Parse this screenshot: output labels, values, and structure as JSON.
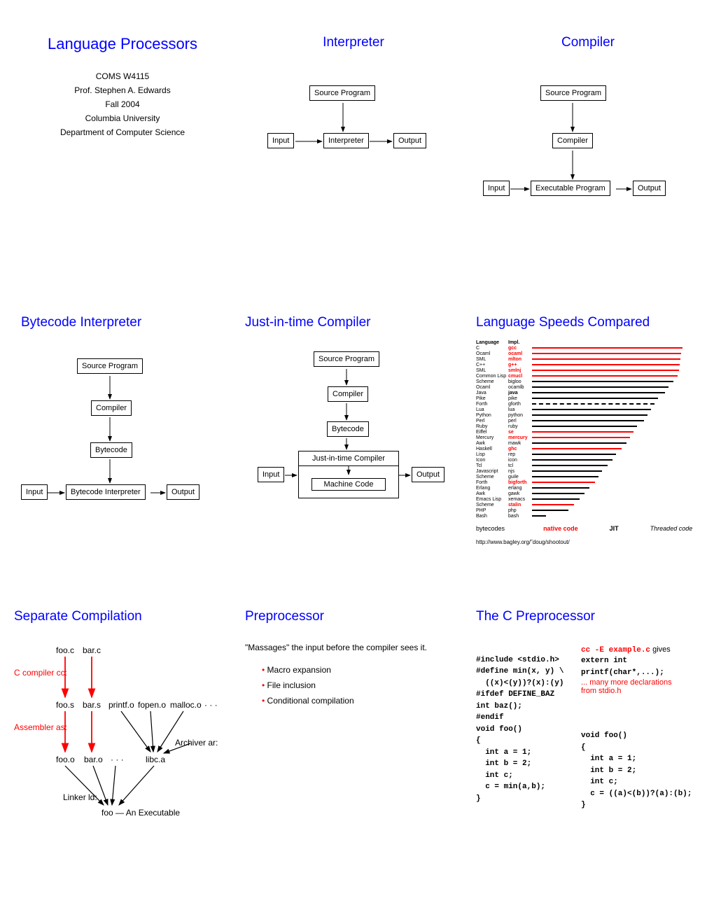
{
  "s1": {
    "title": "Language Processors",
    "course": "COMS W4115",
    "prof": "Prof. Stephen A. Edwards",
    "term": "Fall 2004",
    "univ": "Columbia University",
    "dept": "Department of Computer Science"
  },
  "s2": {
    "title": "Interpreter",
    "src": "Source Program",
    "input": "Input",
    "interp": "Interpreter",
    "output": "Output"
  },
  "s3": {
    "title": "Compiler",
    "src": "Source Program",
    "comp": "Compiler",
    "input": "Input",
    "exe": "Executable Program",
    "output": "Output"
  },
  "s4": {
    "title": "Bytecode Interpreter",
    "src": "Source Program",
    "comp": "Compiler",
    "byte": "Bytecode",
    "input": "Input",
    "bi": "Bytecode Interpreter",
    "output": "Output"
  },
  "s5": {
    "title": "Just-in-time Compiler",
    "src": "Source Program",
    "comp": "Compiler",
    "byte": "Bytecode",
    "jit": "Just-in-time Compiler",
    "mc": "Machine Code",
    "input": "Input",
    "output": "Output"
  },
  "s6": {
    "title": "Language Speeds Compared",
    "h1": "Language",
    "h2": "Impl.",
    "rows": [
      {
        "lang": "C",
        "impl": "gcc",
        "r": true,
        "len": 215
      },
      {
        "lang": "Ocaml",
        "impl": "ocaml",
        "r": true,
        "len": 213
      },
      {
        "lang": "SML",
        "impl": "mlton",
        "r": true,
        "len": 212
      },
      {
        "lang": "C++",
        "impl": "g++",
        "r": true,
        "len": 211
      },
      {
        "lang": "SML",
        "impl": "smlnj",
        "r": true,
        "len": 210
      },
      {
        "lang": "Common Lisp",
        "impl": "cmucl",
        "r": true,
        "len": 208
      },
      {
        "lang": "Scheme",
        "impl": "bigloo",
        "r": false,
        "len": 202
      },
      {
        "lang": "Ocaml",
        "impl": "ocamlb",
        "r": false,
        "len": 195
      },
      {
        "lang": "Java",
        "impl": "java",
        "r": false,
        "len": 190,
        "b": true
      },
      {
        "lang": "Pike",
        "impl": "pike",
        "r": false,
        "len": 180
      },
      {
        "lang": "Forth",
        "impl": "gforth",
        "r": false,
        "len": 175,
        "dash": true
      },
      {
        "lang": "Lua",
        "impl": "lua",
        "r": false,
        "len": 170
      },
      {
        "lang": "Python",
        "impl": "python",
        "r": false,
        "len": 165
      },
      {
        "lang": "Perl",
        "impl": "perl",
        "r": false,
        "len": 160
      },
      {
        "lang": "Ruby",
        "impl": "ruby",
        "r": false,
        "len": 150
      },
      {
        "lang": "Eiffel",
        "impl": "se",
        "r": true,
        "len": 145
      },
      {
        "lang": "Mercury",
        "impl": "mercury",
        "r": true,
        "len": 140
      },
      {
        "lang": "Awk",
        "impl": "mawk",
        "r": false,
        "len": 135
      },
      {
        "lang": "Haskell",
        "impl": "ghc",
        "r": true,
        "len": 128
      },
      {
        "lang": "Lisp",
        "impl": "rep",
        "r": false,
        "len": 120
      },
      {
        "lang": "Icon",
        "impl": "icon",
        "r": false,
        "len": 115
      },
      {
        "lang": "Tcl",
        "impl": "tcl",
        "r": false,
        "len": 108
      },
      {
        "lang": "Javascript",
        "impl": "njs",
        "r": false,
        "len": 100
      },
      {
        "lang": "Scheme",
        "impl": "guile",
        "r": false,
        "len": 95
      },
      {
        "lang": "Forth",
        "impl": "bigforth",
        "r": true,
        "len": 90
      },
      {
        "lang": "Erlang",
        "impl": "erlang",
        "r": false,
        "len": 82
      },
      {
        "lang": "Awk",
        "impl": "gawk",
        "r": false,
        "len": 75
      },
      {
        "lang": "Emacs Lisp",
        "impl": "xemacs",
        "r": false,
        "len": 68
      },
      {
        "lang": "Scheme",
        "impl": "stalin",
        "r": true,
        "len": 60
      },
      {
        "lang": "PHP",
        "impl": "php",
        "r": false,
        "len": 52
      },
      {
        "lang": "Bash",
        "impl": "bash",
        "r": false,
        "len": 20
      }
    ],
    "leg1": "bytecodes",
    "leg2": "native code",
    "leg3": "JIT",
    "leg4": "Threaded code",
    "url": "http://www.bagley.org/˜doug/shootout/"
  },
  "s7": {
    "title": "Separate Compilation",
    "fooc": "foo.c",
    "barc": "bar.c",
    "cc": "C compiler cc:",
    "foos": "foo.s",
    "bars": "bar.s",
    "printf": "printf.o",
    "fopen": "fopen.o",
    "malloc": "malloc.o",
    "dots": "· · ·",
    "as": "Assembler as:",
    "fooo": "foo.o",
    "baro": "bar.o",
    "libc": "libc.a",
    "ar": "Archiver ar:",
    "ld": "Linker ld:",
    "exe": "foo — An Executable"
  },
  "s8": {
    "title": "Preprocessor",
    "desc": "\"Massages\" the input before the compiler sees it.",
    "b1": "Macro expansion",
    "b2": "File inclusion",
    "b3": "Conditional compilation"
  },
  "s9": {
    "title": "The C Preprocessor",
    "left": [
      "",
      "#include <stdio.h>",
      "#define min(x, y) \\",
      "  ((x)<(y))?(x):(y)",
      "#ifdef DEFINE_BAZ",
      "int baz();",
      "#endif",
      "void foo()",
      "{",
      "  int a = 1;",
      "  int b = 2;",
      "  int c;",
      "  c = min(a,b);",
      "}"
    ],
    "rightcmd": "cc -E example.c",
    "gives": " gives",
    "right": [
      "extern int",
      "printf(char*,...);"
    ],
    "more": "... many more declarations",
    "from": "from stdio.h",
    "right2": [
      "void foo()",
      "{",
      "  int a = 1;",
      "  int b = 2;",
      "  int c;",
      "  c = ((a)<(b))?(a):(b);",
      "}"
    ]
  }
}
